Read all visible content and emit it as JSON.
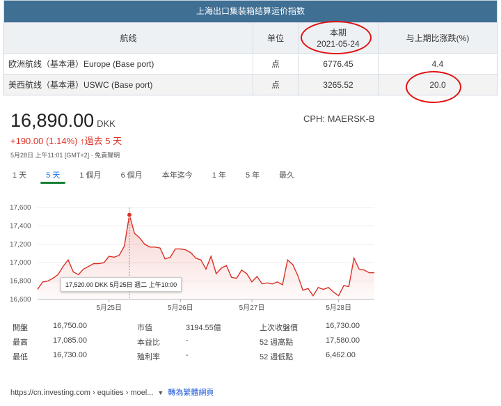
{
  "index_table": {
    "title": "上海出口集装箱结算运价指数",
    "headers": {
      "route": "航线",
      "unit": "单位",
      "period_label": "本期",
      "period_date": "2021-05-24",
      "change": "与上期比涨跌(%)"
    },
    "rows": [
      {
        "route": "欧洲航线（基本港）Europe (Base port)",
        "unit": "点",
        "value": "6776.45",
        "change": "4.4"
      },
      {
        "route": "美西航线（基本港）USWC (Base port)",
        "unit": "点",
        "value": "3265.52",
        "change": "20.0"
      }
    ],
    "highlight_color": "#e01010"
  },
  "stock": {
    "price": "16,890.00",
    "currency": "DKK",
    "ticker": "CPH: MAERSK-B",
    "change": "+190.00 (1.14%)",
    "change_arrow": "arrow-up-icon",
    "change_period": "過去 5 天",
    "timestamp": "5月28日 上午11:01 [GMT+2] · 免責聲明",
    "change_color": "#d93025",
    "tabs": [
      "1 天",
      "5 天",
      "1 個月",
      "6 個月",
      "本年迄今",
      "1 年",
      "5 年",
      "最久"
    ],
    "active_tab": "5 天",
    "tooltip": {
      "value": "17,520.00 DKK",
      "date": "5月25日 週二 上午10:00"
    },
    "stats": [
      {
        "label": "開盤",
        "value": "16,750.00"
      },
      {
        "label": "最高",
        "value": "17,085.00"
      },
      {
        "label": "最低",
        "value": "16,730.00"
      },
      {
        "label": "市值",
        "value": "3194.55億"
      },
      {
        "label": "本益比",
        "value": "-"
      },
      {
        "label": "殖利率",
        "value": "-"
      },
      {
        "label": "上次收盤價",
        "value": "16,730.00"
      },
      {
        "label": "52 週高點",
        "value": "17,580.00"
      },
      {
        "label": "52 週低點",
        "value": "6,462.00"
      }
    ],
    "source_url": "https://cn.investing.com › equities › moel...",
    "translate_label": "轉為繁體網頁"
  },
  "chart_data": {
    "type": "area",
    "ylim": [
      16600,
      17600
    ],
    "yticks": [
      "16,600",
      "16,800",
      "17,000",
      "17,200",
      "17,400",
      "17,600"
    ],
    "xticks": [
      "5月25日",
      "5月26日",
      "5月27日",
      "5月28日"
    ],
    "line_color": "#d93025",
    "series": [
      {
        "values": [
          16710,
          16790,
          16800,
          16830,
          16870,
          16960,
          17030,
          16900,
          16870,
          16930,
          16960,
          16990,
          16990,
          17000,
          17070,
          17060,
          17080,
          17180,
          17520,
          17320,
          17270,
          17200,
          17170,
          17170,
          17160,
          17040,
          17060,
          17150,
          17150,
          17140,
          17110,
          17050,
          17030,
          16930,
          17070,
          16880,
          16940,
          16970,
          16840,
          16830,
          16920,
          16880,
          16790,
          16850,
          16770,
          16780,
          16770,
          16790,
          16760,
          17030,
          16980,
          16860,
          16700,
          16720,
          16640,
          16730,
          16710,
          16730,
          16680,
          16640,
          16750,
          16740,
          17050,
          16930,
          16920,
          16890,
          16890
        ]
      }
    ]
  }
}
